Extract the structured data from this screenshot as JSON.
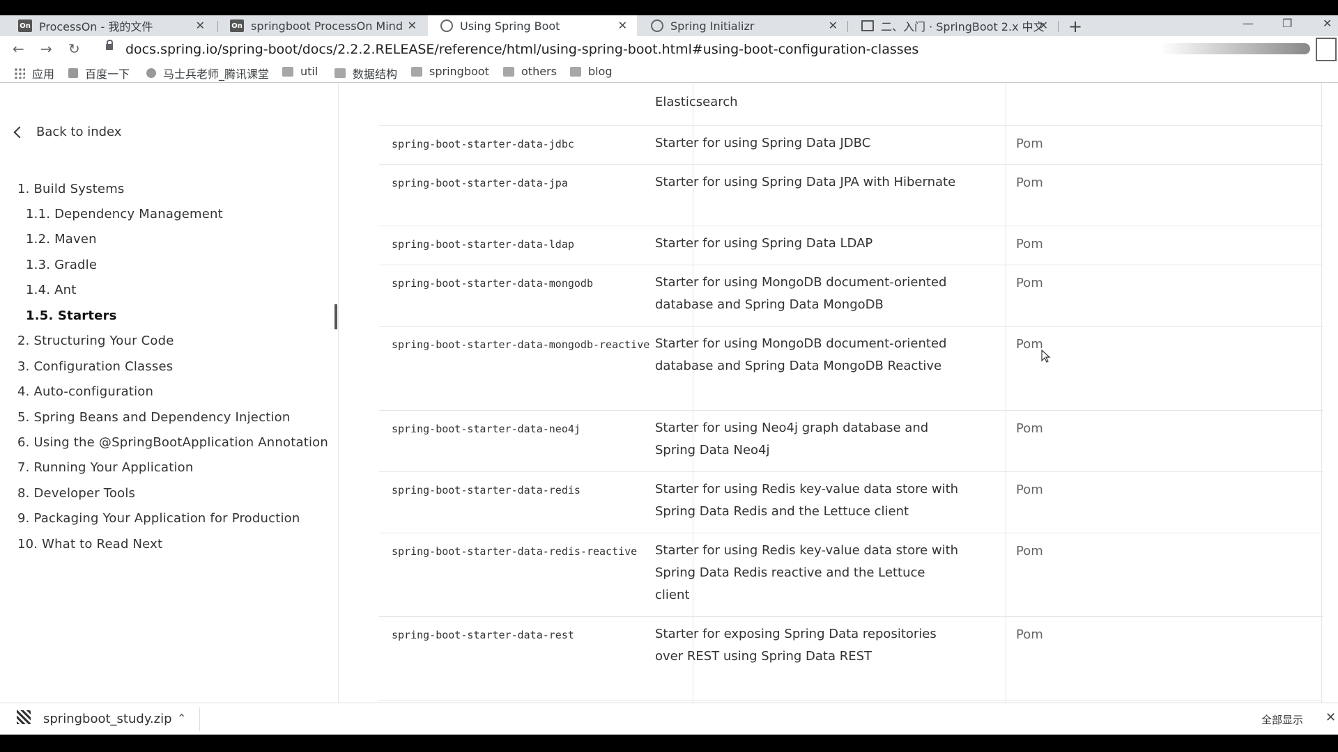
{
  "tabs": [
    {
      "label": "ProcessOn - 我的文件",
      "icon": "processon-icon",
      "active": false
    },
    {
      "label": "springboot ProcessOn Mind",
      "icon": "processon-icon",
      "active": false
    },
    {
      "label": "Using Spring Boot",
      "icon": "spring-icon",
      "active": true
    },
    {
      "label": "Spring Initializr",
      "icon": "spring-icon",
      "active": false
    },
    {
      "label": "二、入门 · SpringBoot 2.x 中文",
      "icon": "book-icon",
      "active": false
    }
  ],
  "tab_icon_text": {
    "processon": "On"
  },
  "url": "docs.spring.io/spring-boot/docs/2.2.2.RELEASE/reference/html/using-spring-boot.html#using-boot-configuration-classes",
  "bookmarks": [
    "应用",
    "百度一下",
    "马士兵老师_腾讯课堂",
    "util",
    "数据结构",
    "springboot",
    "others",
    "blog"
  ],
  "sidebar": {
    "back_label": "Back to index",
    "items": [
      {
        "label": "1. Build Systems",
        "level": 1
      },
      {
        "label": "1.1. Dependency Management",
        "level": 2
      },
      {
        "label": "1.2. Maven",
        "level": 2
      },
      {
        "label": "1.3. Gradle",
        "level": 2
      },
      {
        "label": "1.4. Ant",
        "level": 2
      },
      {
        "label": "1.5. Starters",
        "level": 2,
        "active": true
      },
      {
        "label": "2. Structuring Your Code",
        "level": 1
      },
      {
        "label": "3. Configuration Classes",
        "level": 1
      },
      {
        "label": "4. Auto-configuration",
        "level": 1
      },
      {
        "label": "5. Spring Beans and Dependency Injection",
        "level": 1
      },
      {
        "label": "6. Using the @SpringBootApplication Annotation",
        "level": 1
      },
      {
        "label": "7. Running Your Application",
        "level": 1
      },
      {
        "label": "8. Developer Tools",
        "level": 1
      },
      {
        "label": "9. Packaging Your Application for Production",
        "level": 1
      },
      {
        "label": "10. What to Read Next",
        "level": 1
      }
    ]
  },
  "table": {
    "partial_top_desc": "Elasticsearch",
    "rows": [
      {
        "name": "spring-boot-starter-data-jdbc",
        "desc": "Starter for using Spring Data JDBC",
        "type": "Pom"
      },
      {
        "name": "spring-boot-starter-data-jpa",
        "desc": "Starter for using Spring Data JPA with Hibernate",
        "type": "Pom"
      },
      {
        "name": "spring-boot-starter-data-ldap",
        "desc": "Starter for using Spring Data LDAP",
        "type": "Pom"
      },
      {
        "name": "spring-boot-starter-data-mongodb",
        "desc": "Starter for using MongoDB document-oriented database and Spring Data MongoDB",
        "type": "Pom"
      },
      {
        "name": "spring-boot-starter-data-mongodb-reactive",
        "desc": "Starter for using MongoDB document-oriented database and Spring Data MongoDB Reactive",
        "type": "Pom"
      },
      {
        "name": "spring-boot-starter-data-neo4j",
        "desc": "Starter for using Neo4j graph database and Spring Data Neo4j",
        "type": "Pom"
      },
      {
        "name": "spring-boot-starter-data-redis",
        "desc": "Starter for using Redis key-value data store with Spring Data Redis and the Lettuce client",
        "type": "Pom"
      },
      {
        "name": "spring-boot-starter-data-redis-reactive",
        "desc": "Starter for using Redis key-value data store with Spring Data Redis reactive and the Lettuce client",
        "type": "Pom"
      },
      {
        "name": "spring-boot-starter-data-rest",
        "desc": "Starter for exposing Spring Data repositories over REST using Spring Data REST",
        "type": "Pom"
      }
    ]
  },
  "download": {
    "filename": "springboot_study.zip",
    "show_all": "全部显示"
  }
}
